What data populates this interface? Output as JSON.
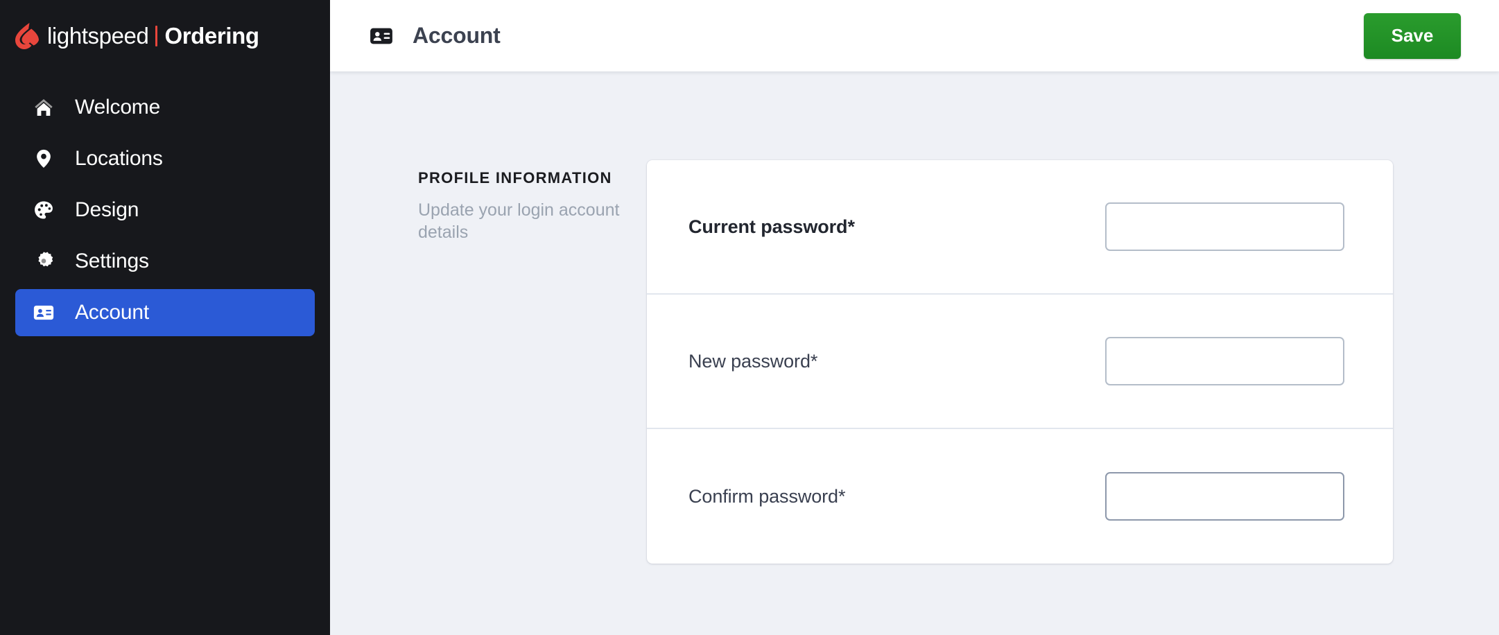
{
  "brand": {
    "logo_icon": "lightspeed-flame-icon",
    "name": "lightspeed",
    "product": "Ordering",
    "accent_color": "#e8463c"
  },
  "sidebar": {
    "background_color": "#17181c",
    "active_color": "#2b5ad6",
    "items": [
      {
        "id": "welcome",
        "label": "Welcome",
        "icon": "home-icon",
        "active": false
      },
      {
        "id": "locations",
        "label": "Locations",
        "icon": "map-pin-icon",
        "active": false
      },
      {
        "id": "design",
        "label": "Design",
        "icon": "palette-icon",
        "active": false
      },
      {
        "id": "settings",
        "label": "Settings",
        "icon": "gear-icon",
        "active": false
      },
      {
        "id": "account",
        "label": "Account",
        "icon": "id-card-icon",
        "active": true
      }
    ]
  },
  "header": {
    "icon": "id-card-icon",
    "title": "Account",
    "save_label": "Save",
    "save_color": "#1d8a23"
  },
  "main": {
    "section": {
      "title": "PROFILE INFORMATION",
      "description": "Update your login account details"
    },
    "form": {
      "rows": [
        {
          "id": "current-password",
          "label": "Current password*",
          "value": "",
          "placeholder": "",
          "bold": true,
          "focused": false
        },
        {
          "id": "new-password",
          "label": "New password*",
          "value": "",
          "placeholder": "",
          "bold": false,
          "focused": false
        },
        {
          "id": "confirm-password",
          "label": "Confirm password*",
          "value": "",
          "placeholder": "",
          "bold": false,
          "focused": true
        }
      ]
    }
  }
}
